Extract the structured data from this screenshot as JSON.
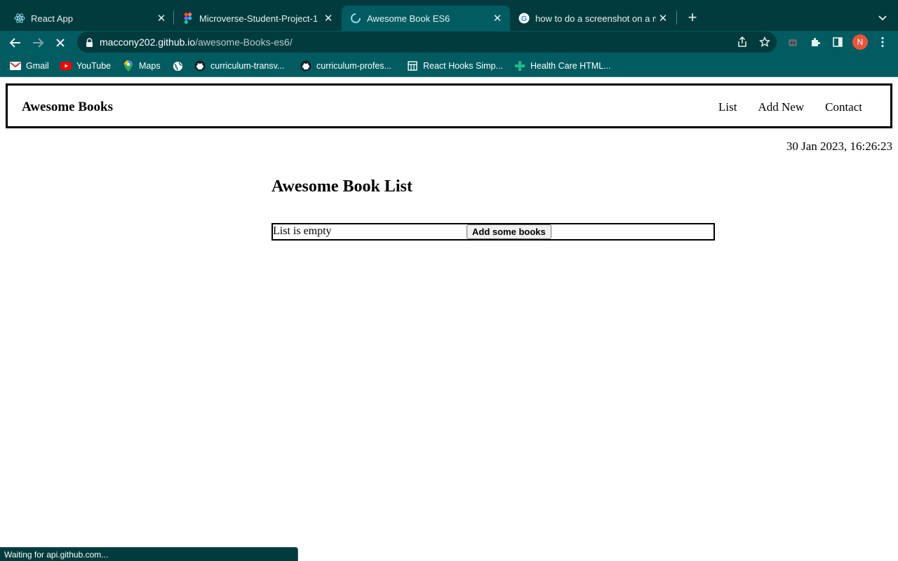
{
  "browser": {
    "tabs": [
      {
        "title": "React App",
        "icon": "react-icon"
      },
      {
        "title": "Microverse-Student-Project-1",
        "icon": "figma-icon"
      },
      {
        "title": "Awesome Book ES6",
        "icon": "loading-spinner-icon",
        "active": true
      },
      {
        "title": "how to do a screenshot on a m",
        "icon": "google-icon"
      }
    ],
    "url": {
      "host": "maccony202.github.io",
      "path": "/awesome-Books-es6/"
    },
    "avatar_letter": "N",
    "bookmarks": [
      {
        "label": "Gmail",
        "icon": "gmail-icon"
      },
      {
        "label": "YouTube",
        "icon": "youtube-icon"
      },
      {
        "label": "Maps",
        "icon": "maps-icon"
      },
      {
        "label": "",
        "icon": "globe-icon"
      },
      {
        "label": "curriculum-transv...",
        "icon": "github-icon"
      },
      {
        "label": "curriculum-profes...",
        "icon": "github-icon"
      },
      {
        "label": "React Hooks Simp...",
        "icon": "bookmark-page-icon"
      },
      {
        "label": "Health Care HTML...",
        "icon": "health-cross-icon"
      }
    ],
    "status_text": "Waiting for api.github.com...",
    "colors": {
      "tabbar": "#023b3e",
      "toolbar": "#005c61",
      "avatar": "#e8553b"
    }
  },
  "site": {
    "logo": "Awesome Books",
    "nav": [
      "List",
      "Add New",
      "Contact"
    ],
    "datetime": "30 Jan 2023, 16:26:23",
    "section_title": "Awesome Book List",
    "empty_message": "List is empty",
    "add_button_label": "Add some books"
  }
}
